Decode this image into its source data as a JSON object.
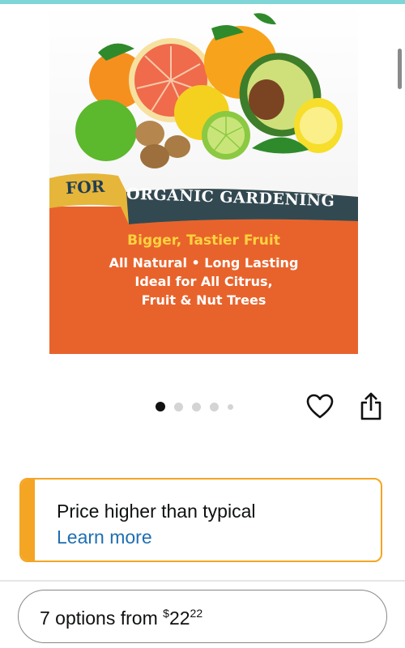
{
  "product_image": {
    "badge_left": "FOR",
    "badge_right": "ORGANIC GARDENING",
    "headline": "Bigger, Tastier Fruit",
    "line1": "All Natural • Long Lasting",
    "line2": "Ideal for All Citrus,",
    "line3": "Fruit & Nut Trees"
  },
  "carousel": {
    "total_dots": 5,
    "active_index": 0
  },
  "price_notice": {
    "message": "Price higher than typical",
    "link": "Learn more"
  },
  "options": {
    "label": "7 options from ",
    "currency": "$",
    "whole": "22",
    "fraction": "22"
  },
  "colors": {
    "accent_top_bar": "#7fd6d6",
    "notice_border": "#f5a524",
    "link": "#1f6eb3",
    "bag_orange": "#e8632c",
    "banner_gold": "#e6b63a"
  },
  "icons": [
    "heart-icon",
    "share-icon"
  ]
}
